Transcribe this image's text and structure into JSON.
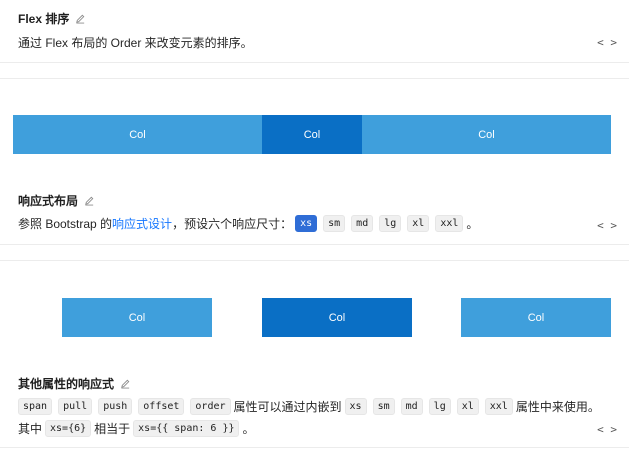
{
  "sections": [
    {
      "title": "Flex 排序",
      "desc_prefix": "通过 Flex 布局的 Order 来改变元素的排序。"
    },
    {
      "title": "响应式布局",
      "desc_prefix": "参照 Bootstrap 的 ",
      "desc_link": "响应式设计",
      "desc_mid": "，预设六个响应尺寸：",
      "sizes": [
        "xs",
        "sm",
        "md",
        "lg",
        "xl",
        "xxl"
      ],
      "desc_end": "。"
    },
    {
      "title": "其他属性的响应式",
      "props": [
        "span",
        "pull",
        "push",
        "offset",
        "order"
      ],
      "desc_mid": "属性可以通过内嵌到",
      "sizes": [
        "xs",
        "sm",
        "md",
        "lg",
        "xl",
        "xxl"
      ],
      "desc_end": "属性中来使用。",
      "line2_prefix": "其中",
      "code_a": "xs={6}",
      "line2_mid": "相当于",
      "code_b": "xs={{ span: 6 }}",
      "line2_end": "。"
    }
  ],
  "toggle": "< >",
  "demo1": {
    "cols": [
      "Col",
      "Col",
      "Col"
    ]
  },
  "demo2": {
    "cols": [
      "Col",
      "Col",
      "Col"
    ]
  },
  "colors": {
    "col_light": "#3f9fdc",
    "col_dark": "#0a6fc5",
    "link": "#1677ff",
    "selected_code": "#2f6dd6"
  }
}
